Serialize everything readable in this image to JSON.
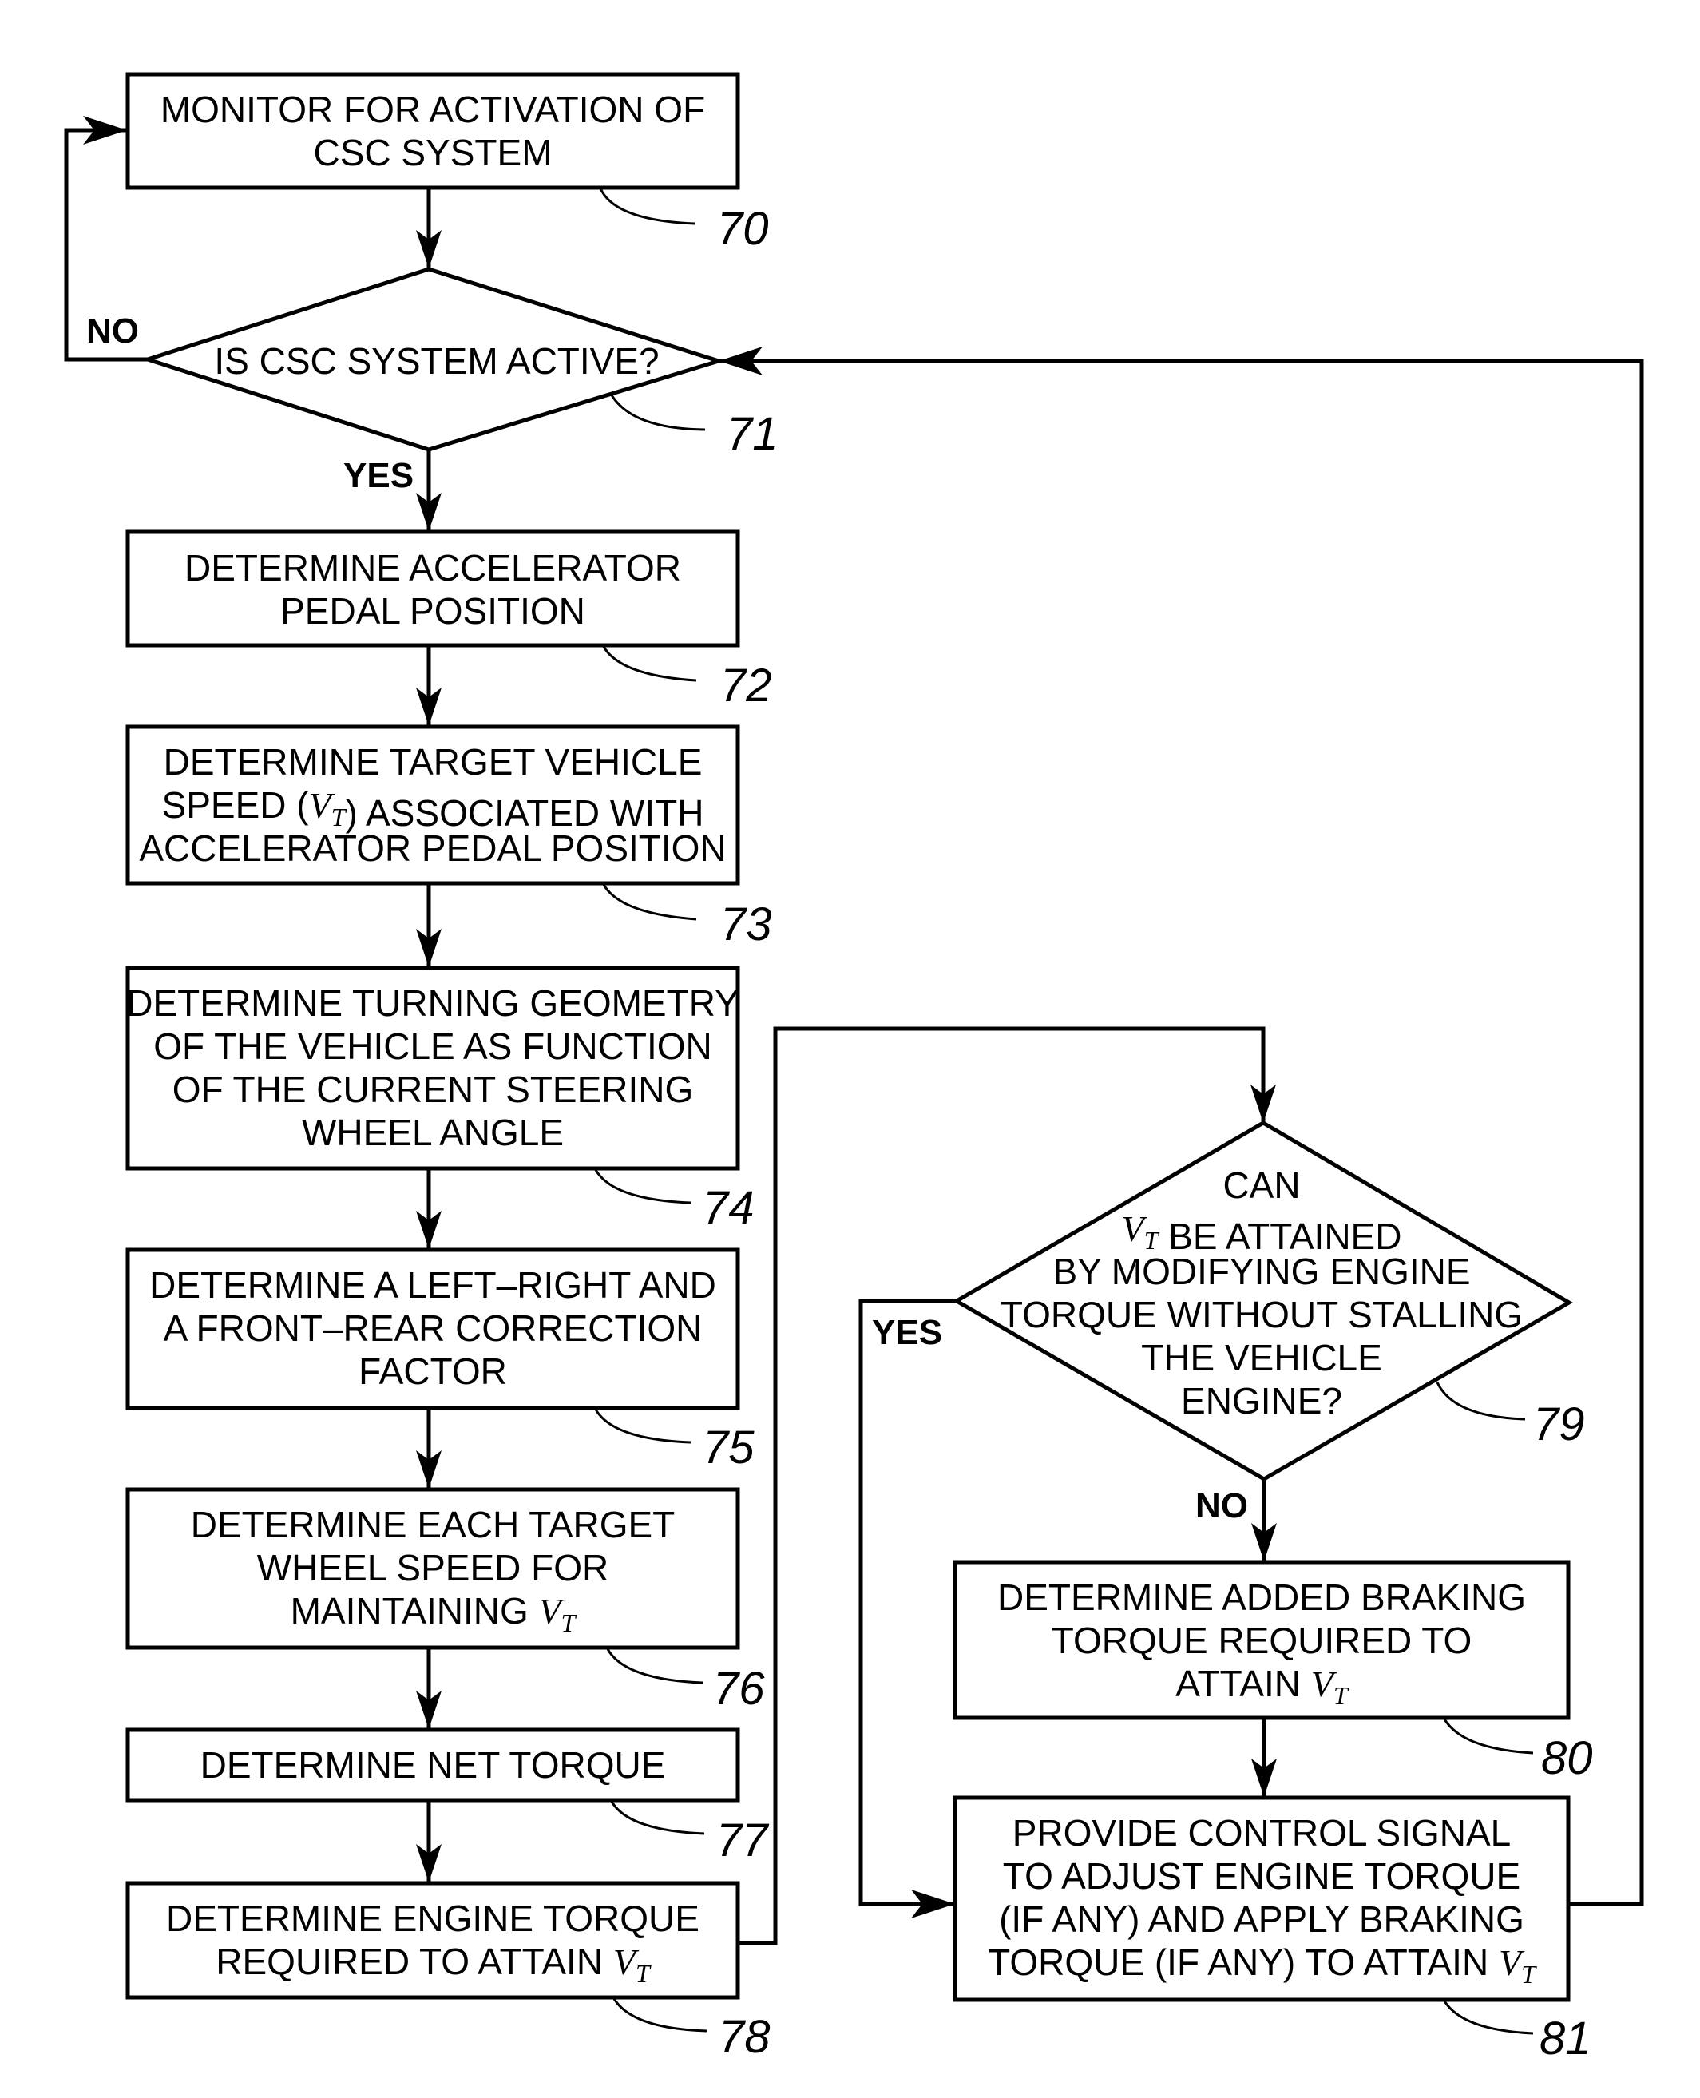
{
  "figure": {
    "colors": {
      "ink": "#000000",
      "background": "#ffffff"
    },
    "nodes": [
      {
        "id": "70",
        "kind": "process",
        "lines": [
          "MONITOR FOR ACTIVATION OF",
          "CSC SYSTEM"
        ]
      },
      {
        "id": "71",
        "kind": "decision",
        "lines": [
          "IS CSC SYSTEM ACTIVE?"
        ]
      },
      {
        "id": "72",
        "kind": "process",
        "lines": [
          "DETERMINE ACCELERATOR",
          "PEDAL POSITION"
        ]
      },
      {
        "id": "73",
        "kind": "process",
        "lines": [
          "DETERMINE TARGET VEHICLE",
          "SPEED (|V_T|) ASSOCIATED WITH",
          "ACCELERATOR PEDAL POSITION"
        ]
      },
      {
        "id": "74",
        "kind": "process",
        "lines": [
          "DETERMINE TURNING GEOMETRY",
          "OF THE VEHICLE AS FUNCTION",
          "OF THE CURRENT STEERING",
          "WHEEL ANGLE"
        ]
      },
      {
        "id": "75",
        "kind": "process",
        "lines": [
          "DETERMINE A LEFT–RIGHT AND",
          "A FRONT–REAR CORRECTION",
          "FACTOR"
        ]
      },
      {
        "id": "76",
        "kind": "process",
        "lines": [
          "DETERMINE EACH TARGET",
          "WHEEL SPEED FOR",
          "MAINTAINING |V_T|"
        ]
      },
      {
        "id": "77",
        "kind": "process",
        "lines": [
          "DETERMINE NET TORQUE"
        ]
      },
      {
        "id": "78",
        "kind": "process",
        "lines": [
          "DETERMINE ENGINE TORQUE",
          "REQUIRED TO ATTAIN |V_T|"
        ]
      },
      {
        "id": "79",
        "kind": "decision",
        "lines": [
          "CAN",
          "|V_T| BE ATTAINED",
          "BY MODIFYING ENGINE",
          "TORQUE WITHOUT STALLING",
          "THE VEHICLE",
          "ENGINE?"
        ]
      },
      {
        "id": "80",
        "kind": "process",
        "lines": [
          "DETERMINE ADDED BRAKING",
          "TORQUE REQUIRED TO",
          "ATTAIN |V_T|"
        ]
      },
      {
        "id": "81",
        "kind": "process",
        "lines": [
          "PROVIDE CONTROL SIGNAL",
          "TO ADJUST ENGINE TORQUE",
          "(IF ANY) AND APPLY BRAKING",
          "TORQUE (IF ANY) TO ATTAIN |V_T|"
        ]
      }
    ],
    "edge_labels": {
      "d71_no": "NO",
      "d71_yes": "YES",
      "d79_yes": "YES",
      "d79_no": "NO"
    },
    "vt_symbol": {
      "base": "V",
      "sub": "T"
    }
  }
}
